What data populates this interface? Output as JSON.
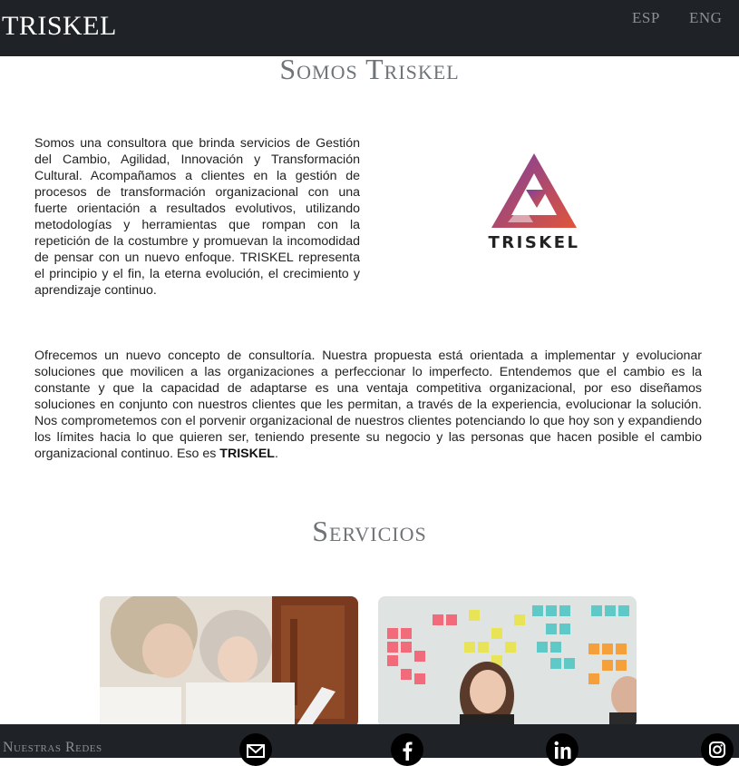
{
  "header": {
    "brand": "TRISKEL",
    "lang_esp": "ESP",
    "lang_eng": "ENG"
  },
  "about": {
    "title": "Somos Triskel",
    "paragraph1": "Somos una consultora que brinda servicios de Gestión del Cambio, Agilidad, Innovación y Transformación Cultural. Acompañamos a clientes en la gestión de procesos de transformación organizacional con una fuerte orientación a resultados evolutivos, utilizando metodologías y herramientas que rompan con la repetición de la costumbre y promuevan la incomodidad de pensar con un nuevo enfoque. TRISKEL representa el principio y el fin, la eterna evolución, el crecimiento y aprendizaje continuo.",
    "paragraph2_main": "Ofrecemos un nuevo concepto de consultoría. Nuestra propuesta está orientada a implementar y evolucionar soluciones que movilicen a las organizaciones a perfeccionar lo imperfecto. Entendemos que el cambio es la constante y que la capacidad de adaptarse es una ventaja competitiva organizacional, por eso diseñamos soluciones en conjunto con nuestros clientes que les permitan, a través de la experiencia, evolucionar la solución. Nos comprometemos con el porvenir organizacional de nuestros clientes potenciando lo que hoy son y expandiendo los límites hacia lo que quieren ser, teniendo presente su negocio y las personas que hacen posible el cambio organizacional continuo. Eso es ",
    "paragraph2_bold": "TRISKEL",
    "paragraph2_end": ".",
    "logo_text": "TRISKEL"
  },
  "services": {
    "title": "Servicios"
  },
  "footer": {
    "title": "Nuestras Redes",
    "icons": [
      "mail-icon",
      "facebook-icon",
      "linkedin-icon",
      "instagram-icon"
    ]
  },
  "colors": {
    "header_bg": "#1f2226",
    "title_gray": "#6f7478",
    "logo_gradient_start": "#7b3fa0",
    "logo_gradient_end": "#e0553a"
  }
}
